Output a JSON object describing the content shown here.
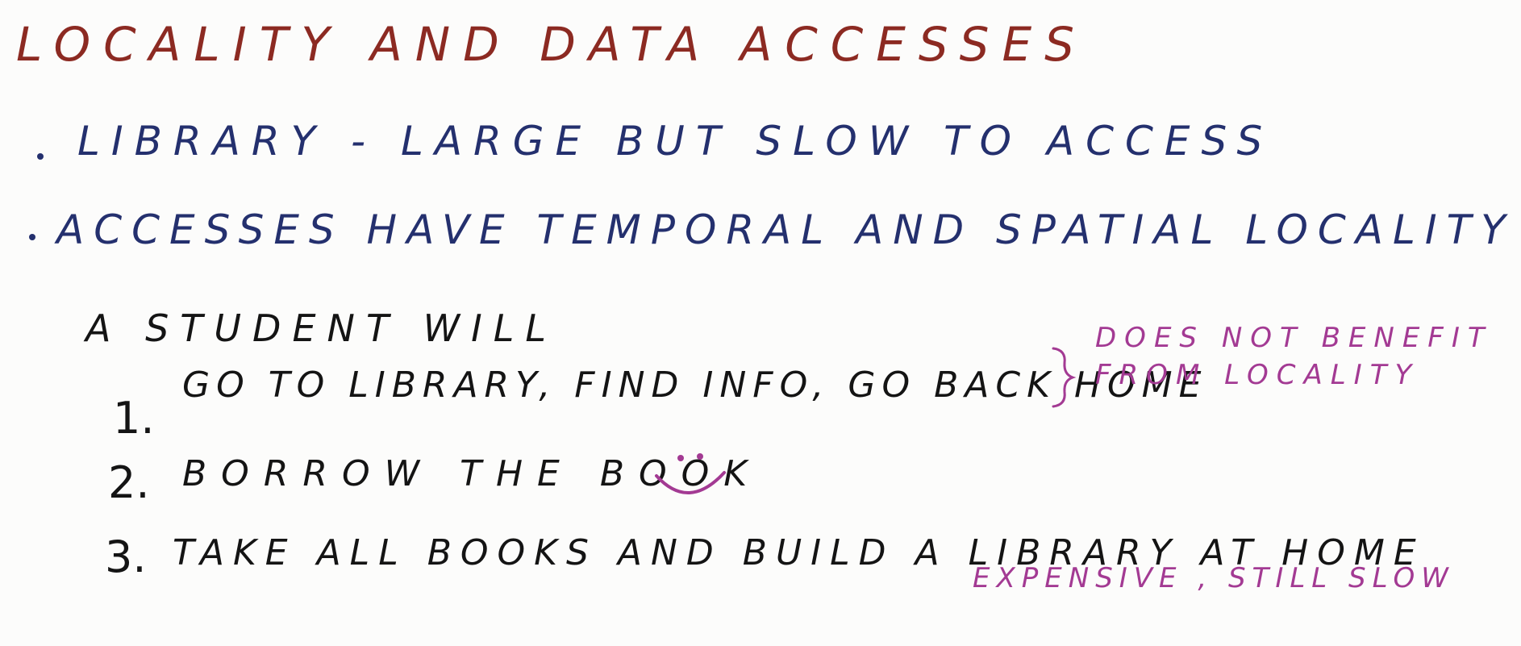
{
  "title": "LOCALITY AND DATA ACCESSES",
  "bullets": [
    "LIBRARY - LARGE BUT SLOW TO ACCESS",
    "ACCESSES HAVE TEMPORAL AND SPATIAL LOCALITY"
  ],
  "student_heading": "A STUDENT WILL",
  "items": [
    {
      "number": "1.",
      "text": "GO TO LIBRARY, FIND INFO, GO BACK HOME"
    },
    {
      "number": "2.",
      "text": "BORROW THE BOOK"
    },
    {
      "number": "3.",
      "text": "TAKE ALL BOOKS AND BUILD A LIBRARY AT HOME"
    }
  ],
  "annotations": {
    "item1_line1": "DOES NOT BENEFIT",
    "item1_line2": "FROM LOCALITY",
    "item3": "EXPENSIVE , STILL SLOW"
  },
  "colors": {
    "title": "#8c2a22",
    "bullets": "#24306e",
    "body": "#141414",
    "annotation": "#a33a93",
    "background": "#fcfcfb"
  },
  "icons": {
    "smiley": "smiley-face-icon",
    "brace": "right-brace-icon"
  }
}
